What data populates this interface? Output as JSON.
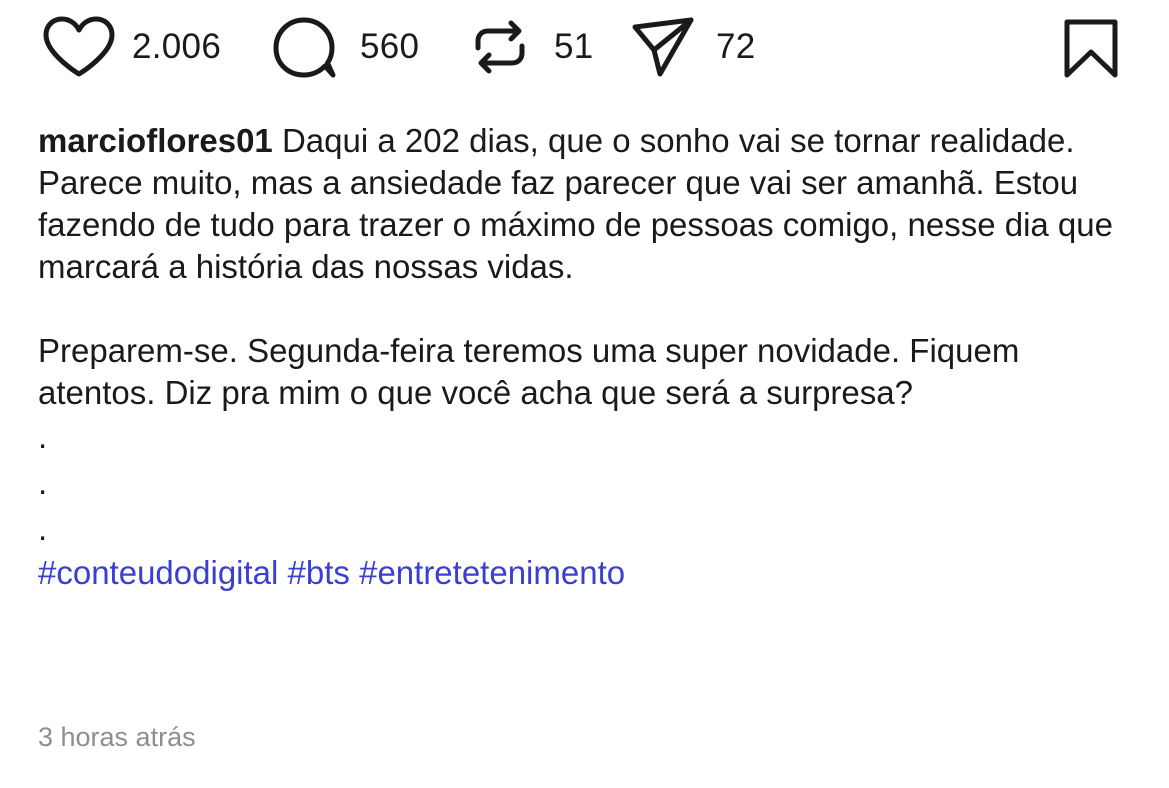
{
  "actions": {
    "like_count": "2.006",
    "comment_count": "560",
    "repost_count": "51",
    "share_count": "72"
  },
  "post": {
    "username": "marcioflores01",
    "paragraph1": "Daqui a 202 dias, que o sonho vai se tornar realidade. Parece muito, mas a ansiedade faz parecer que vai ser amanhã. Estou fazendo de tudo para trazer o máximo de pessoas comigo, nesse dia que marcará a história das nossas vidas.",
    "paragraph2": "Preparem-se. Segunda-feira teremos uma super novidade. Fiquem atentos. Diz pra mim o que você acha que será a surpresa?",
    "dots": [
      ".",
      ".",
      "."
    ],
    "hashtags": [
      "#conteudodigital",
      "#bts",
      "#entretetenimento"
    ],
    "timestamp": "3 horas atrás"
  },
  "colors": {
    "hashtag": "#3b3fd1",
    "timestamp": "#8e8e8e",
    "text": "#1a1a1a"
  },
  "icons": {
    "like": "heart-icon",
    "comment": "comment-bubble-icon",
    "repost": "repost-icon",
    "share": "paper-plane-icon",
    "save": "bookmark-icon"
  }
}
